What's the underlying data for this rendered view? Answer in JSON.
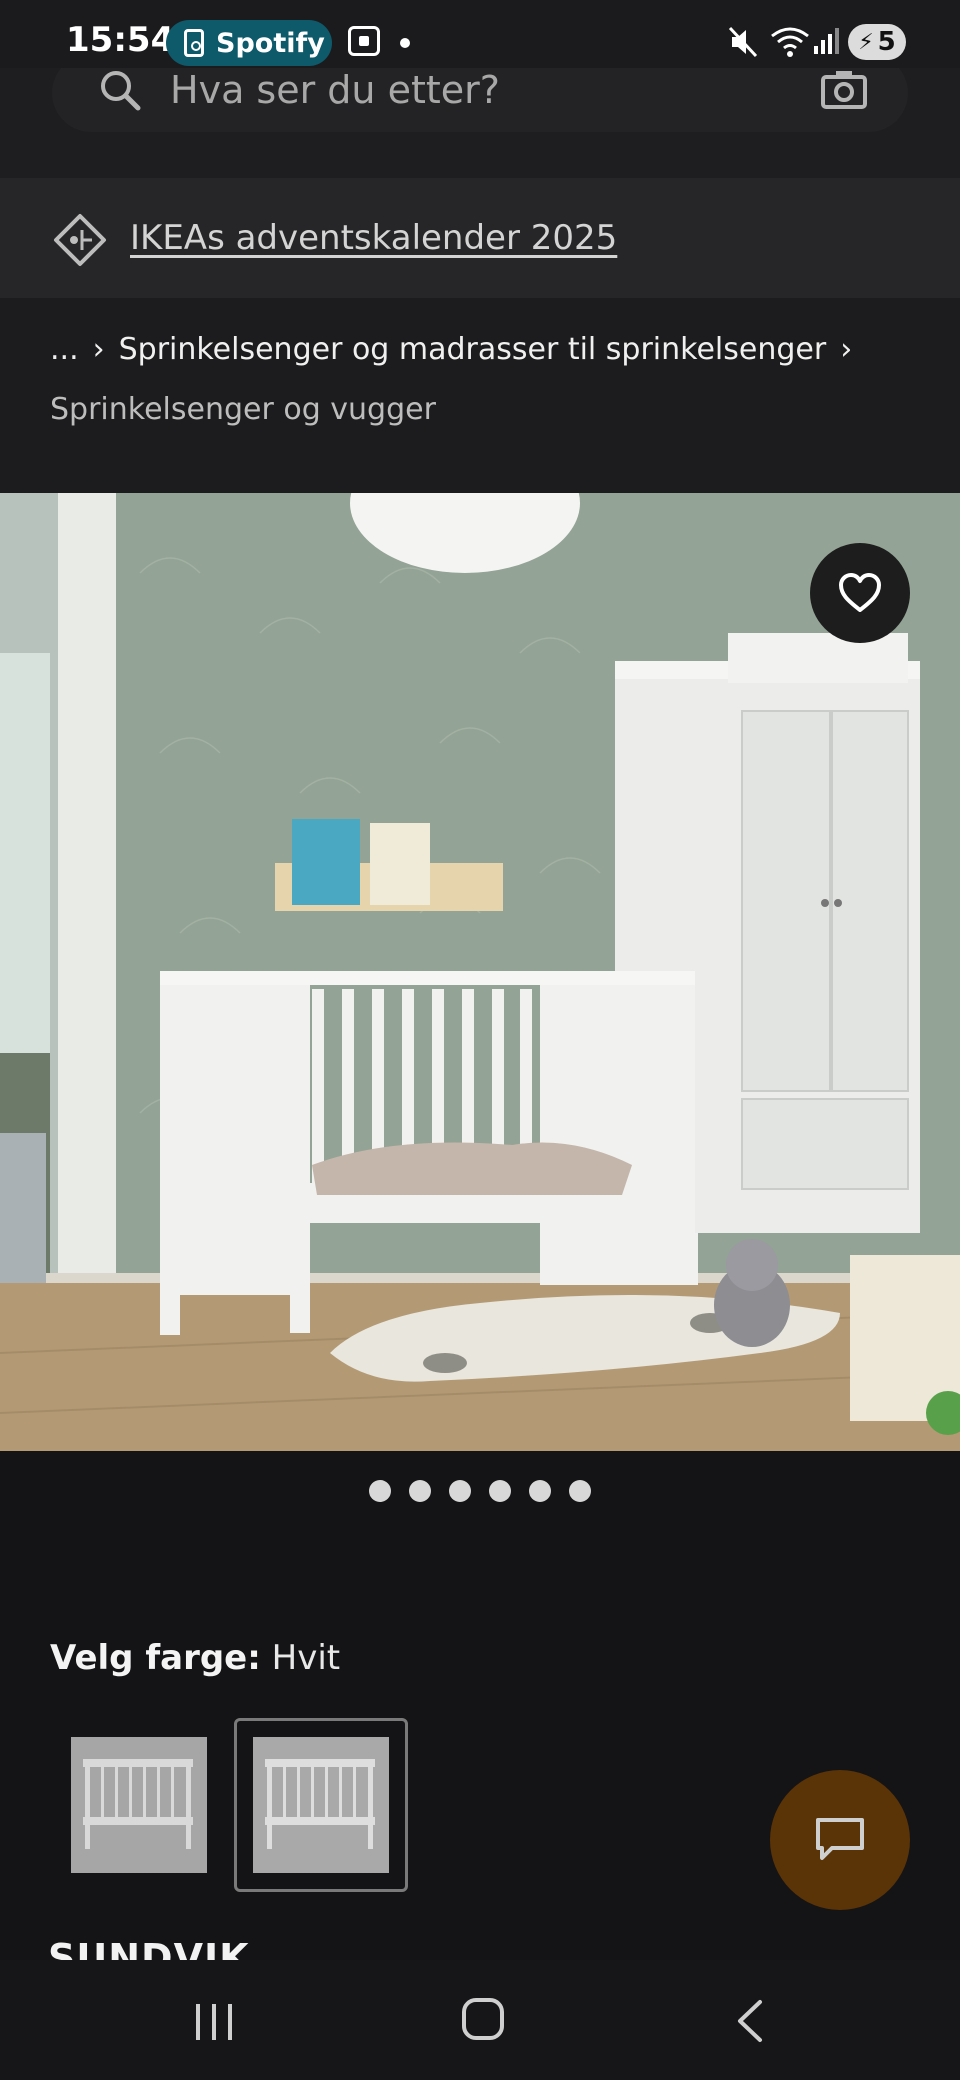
{
  "status_bar": {
    "time": "15:54",
    "media_app": "Spotify",
    "battery": "5",
    "icons": [
      "spotify-icon",
      "screen-record-icon",
      "mute-icon",
      "wifi-icon",
      "signal-icon",
      "battery-charging-icon"
    ]
  },
  "search": {
    "placeholder": "Hva ser du etter?",
    "icons": [
      "search-icon",
      "camera-icon"
    ]
  },
  "promo": {
    "link_text": "IKEAs adventskalender 2025",
    "icon": "price-tag-icon"
  },
  "breadcrumb": {
    "ellipsis": "...",
    "parent": "Sprinkelsenger og madrasser til sprinkelsenger",
    "current": "Sprinkelsenger og vugger"
  },
  "hero": {
    "favorite_icon": "heart-icon"
  },
  "carousel": {
    "dot_count": 6
  },
  "color_select": {
    "label": "Velg farge:",
    "value": "Hvit",
    "selected_index": 1
  },
  "product": {
    "name": "SUNDVIK"
  },
  "chat": {
    "icon": "chat-bubble-icon",
    "color": "#5a3306"
  },
  "nav": {
    "icons": [
      "recents-icon",
      "home-icon",
      "back-icon"
    ]
  }
}
